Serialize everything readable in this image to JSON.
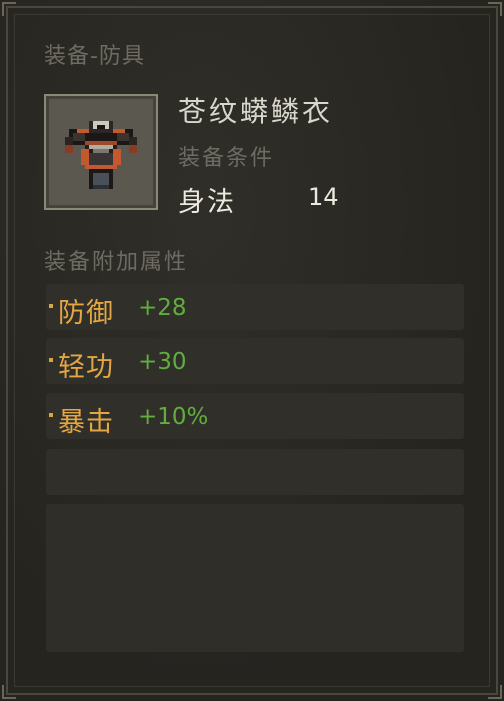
{
  "item": {
    "category": "装备-防具",
    "name": "苍纹蟒鳞衣",
    "icon": "armor-icon",
    "requirement_label": "装备条件",
    "requirement_stat": "身法",
    "requirement_value": "14"
  },
  "bonus": {
    "label": "装备附加属性",
    "attributes": [
      {
        "name": "防御",
        "value": "+28"
      },
      {
        "name": "轻功",
        "value": "+30"
      },
      {
        "name": "暴击",
        "value": "+10%"
      }
    ]
  },
  "colors": {
    "attribute_name": "#e3a642",
    "attribute_value": "#5fae3e",
    "muted_text": "#6e6b63"
  }
}
